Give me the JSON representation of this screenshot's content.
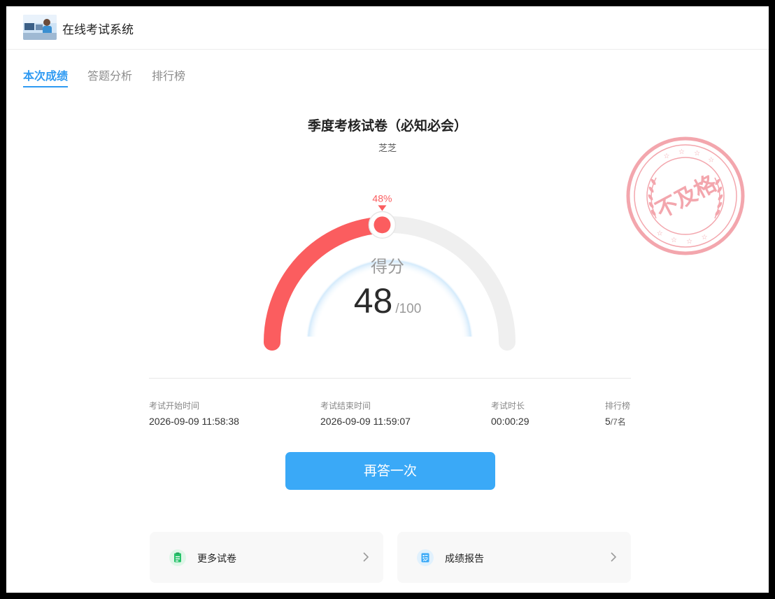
{
  "app": {
    "title": "在线考试系统",
    "logo": "exam-system-logo"
  },
  "tabs": [
    {
      "label": "本次成绩",
      "active": true
    },
    {
      "label": "答题分析",
      "active": false
    },
    {
      "label": "排行榜",
      "active": false
    }
  ],
  "exam": {
    "title": "季度考核试卷（必知必会）",
    "user": "芝芝"
  },
  "score": {
    "label": "得分",
    "value": "48",
    "total": "/100",
    "percent_label": "48%",
    "fraction": 0.48
  },
  "stamp": {
    "text": "不及格",
    "color": "#f3a6ad"
  },
  "info": {
    "start": {
      "label": "考试开始时间",
      "value": "2026-09-09 11:58:38"
    },
    "end": {
      "label": "考试结束时间",
      "value": "2026-09-09 11:59:07"
    },
    "duration": {
      "label": "考试时长",
      "value": "00:00:29"
    },
    "rank": {
      "label": "排行榜",
      "value": "5",
      "total": "/7名"
    }
  },
  "retry_button": {
    "label": "再答一次"
  },
  "cards": [
    {
      "label": "更多试卷",
      "icon": "clipboard-icon",
      "color": "#27c36a"
    },
    {
      "label": "成绩报告",
      "icon": "report-icon",
      "color": "#3aa9f7"
    }
  ],
  "colors": {
    "accent": "#2f9af2",
    "gauge_fill": "#fb5d5f",
    "gauge_track": "#efefef",
    "button": "#3aa9f7"
  }
}
